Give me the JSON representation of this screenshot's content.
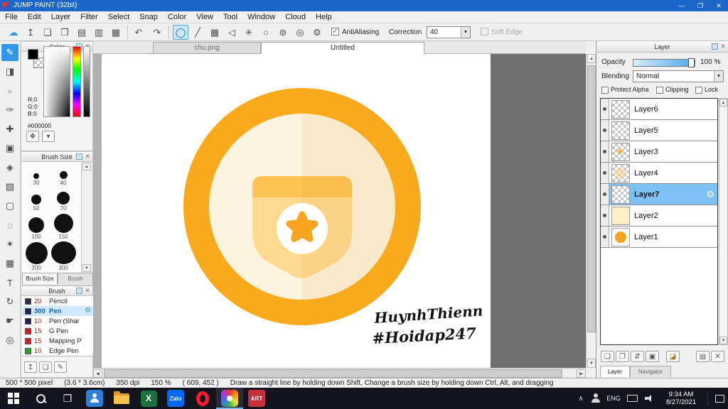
{
  "window": {
    "title": "JUMP PAINT (32bit)",
    "controls": {
      "minimize": "—",
      "maximize": "❐",
      "close": "✕"
    }
  },
  "ui": {
    "up": "▲",
    "down": "▼",
    "left": "◀",
    "right": "▶",
    "dropdown": "▾",
    "check": "✓",
    "close_x": "✕",
    "gear": "⚙"
  },
  "menu": {
    "items": [
      "File",
      "Edit",
      "Layer",
      "Filter",
      "Select",
      "Snap",
      "Color",
      "View",
      "Tool",
      "Window",
      "Cloud",
      "Help"
    ]
  },
  "toolbar": {
    "file_icons": [
      {
        "name": "save",
        "glyph": "☁"
      },
      {
        "name": "export",
        "glyph": "↥"
      },
      {
        "name": "comment",
        "glyph": "❏"
      },
      {
        "name": "publish",
        "glyph": "❒"
      },
      {
        "name": "copy-page",
        "glyph": "▤"
      },
      {
        "name": "pages",
        "glyph": "▥"
      },
      {
        "name": "koma-grid",
        "glyph": "▦"
      }
    ],
    "undo_glyph": "↶",
    "redo_glyph": "↷",
    "draw_icons": [
      {
        "name": "ellipse",
        "glyph": "◯",
        "selected": true
      },
      {
        "name": "straight-line",
        "glyph": "╱"
      },
      {
        "name": "grid",
        "glyph": "▦"
      },
      {
        "name": "arrow",
        "glyph": "◁"
      },
      {
        "name": "symmetry",
        "glyph": "✳"
      },
      {
        "name": "circle",
        "glyph": "○"
      },
      {
        "name": "spiral",
        "glyph": "⊚"
      },
      {
        "name": "perspective",
        "glyph": "◎"
      },
      {
        "name": "material-settings",
        "glyph": "⚙"
      }
    ],
    "antialiasing_label": "AntiAliasing",
    "antialiasing_checked": true,
    "correction_label": "Correction",
    "correction_value": "40",
    "softedge_label": "Soft Edge",
    "softedge_enabled": false
  },
  "side_tools": [
    {
      "name": "brush",
      "glyph": "✎",
      "selected": true
    },
    {
      "name": "eraser",
      "glyph": "◨"
    },
    {
      "name": "dot",
      "glyph": "▫"
    },
    {
      "name": "pen",
      "glyph": "✑"
    },
    {
      "name": "move",
      "glyph": "✚"
    },
    {
      "name": "select-pen",
      "glyph": "▣"
    },
    {
      "name": "bucket",
      "glyph": "◈"
    },
    {
      "name": "gradient",
      "glyph": "▧"
    },
    {
      "name": "select-rect",
      "glyph": "▢"
    },
    {
      "name": "lasso",
      "glyph": "◌"
    },
    {
      "name": "magic-wand",
      "glyph": "✶"
    },
    {
      "name": "pattern",
      "glyph": "▦"
    },
    {
      "name": "text",
      "glyph": "T"
    },
    {
      "name": "rotate",
      "glyph": "↻"
    },
    {
      "name": "hand",
      "glyph": "☛"
    },
    {
      "name": "zoom",
      "glyph": "◎"
    }
  ],
  "documents": {
    "tabs": [
      {
        "label": "chu.png",
        "active": false
      },
      {
        "label": "Untitled",
        "active": true
      }
    ]
  },
  "color_panel": {
    "title": "Color",
    "r": "R:0",
    "g": "G:0",
    "b": "B:0",
    "hex": "#000000",
    "buttons": [
      {
        "name": "palette",
        "glyph": "❖"
      },
      {
        "name": "color-menu",
        "glyph": "▾"
      }
    ]
  },
  "brush_size_panel": {
    "title": "Brush Size",
    "sizes": [
      "30",
      "40",
      "50",
      "70",
      "100",
      "150",
      "200",
      "300"
    ],
    "tabs": [
      "Brush Size",
      "Brush Control"
    ]
  },
  "brush_panel": {
    "title": "Brush",
    "brushes": [
      {
        "size": "20",
        "name": "Pencil",
        "swatch": "#2b2b3e",
        "selected": false
      },
      {
        "size": "300",
        "name": "Pen",
        "swatch": "#232347",
        "selected": true
      },
      {
        "size": "10",
        "name": "Pen (Shar",
        "swatch": "#232347",
        "selected": false
      },
      {
        "size": "15",
        "name": "G Pen",
        "swatch": "#c32430",
        "selected": false
      },
      {
        "size": "15",
        "name": "Mapping P",
        "swatch": "#c32430",
        "selected": false
      },
      {
        "size": "10",
        "name": "Edge Pen",
        "swatch": "#2e9e3a",
        "selected": false
      }
    ],
    "buttons": [
      {
        "name": "add-brush",
        "glyph": "↥"
      },
      {
        "name": "new-brush",
        "glyph": "❏"
      },
      {
        "name": "edit-brush",
        "glyph": "✎"
      }
    ]
  },
  "layer_panel": {
    "title": "Layer",
    "opacity_label": "Opacity",
    "opacity_value": "100 %",
    "blending_label": "Blending",
    "blending_value": "Normal",
    "protect_alpha_label": "Protect Alpha",
    "clipping_label": "Clipping",
    "lock_label": "Lock",
    "layers": [
      {
        "name": "Layer6",
        "selected": false
      },
      {
        "name": "Layer5",
        "selected": false
      },
      {
        "name": "Layer3",
        "selected": false
      },
      {
        "name": "Layer4",
        "selected": false
      },
      {
        "name": "Layer7",
        "selected": true
      },
      {
        "name": "Layer2",
        "selected": false
      },
      {
        "name": "Layer1",
        "selected": false
      }
    ],
    "buttons": [
      {
        "name": "new-layer",
        "glyph": "❏"
      },
      {
        "name": "duplicate-layer",
        "glyph": "❐"
      },
      {
        "name": "move-layer",
        "glyph": "⇵"
      },
      {
        "name": "merge-layer",
        "glyph": "▣"
      },
      {
        "name": "layer-folder",
        "glyph": "◪"
      },
      {
        "name": "layer-material",
        "glyph": "▤"
      },
      {
        "name": "delete-layer",
        "glyph": "✕"
      }
    ],
    "tabs": [
      "Layer",
      "Navigator"
    ]
  },
  "canvas": {
    "signature": [
      "HuynhThienn",
      "#Hoidap247"
    ],
    "colors": {
      "ring": "#F9A91C",
      "inner": "#FCF3DC",
      "band": "#FCC254",
      "shield": "#FFD98F",
      "star": "#F6A41F"
    }
  },
  "statusbar": {
    "size": "500 * 500 pixel",
    "dimensions": "(3.6 * 3.6cm)",
    "dpi": "350 dpi",
    "zoom": "150 %",
    "coords": "( 609, 452 )",
    "hint": "Draw a straight line by holding down Shift, Change a brush size by holding down Ctrl, Alt, and dragging"
  },
  "taskbar": {
    "app_labels": {
      "excel": "X",
      "zalo": "Zalo",
      "art": "ART"
    },
    "language": "ENG",
    "time": "9:34 AM",
    "date": "8/27/2021"
  }
}
